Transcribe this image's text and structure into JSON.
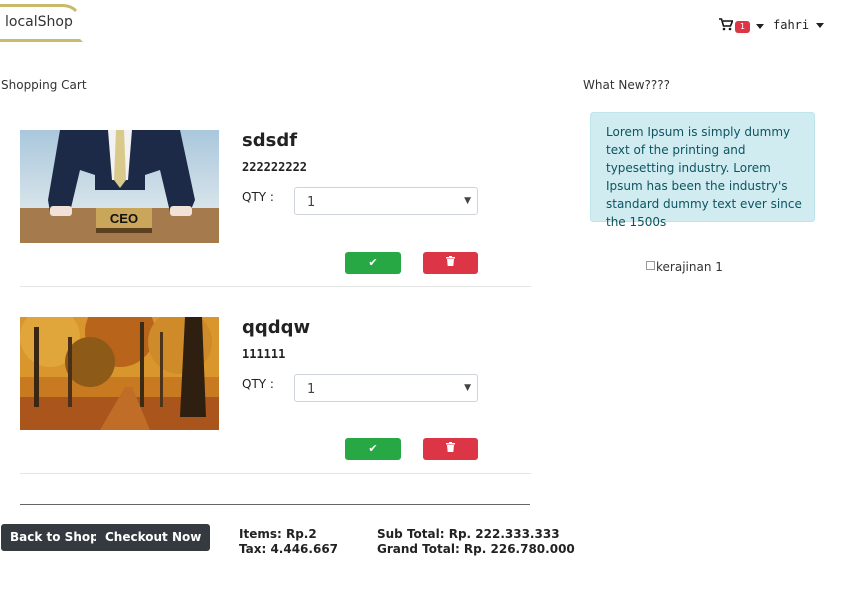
{
  "navbar": {
    "brand": "localShop",
    "cart_badge": "1",
    "user": "fahri"
  },
  "cart": {
    "title": "Shopping Cart",
    "items": [
      {
        "name": "sdsdf",
        "price": "222222222",
        "qty_label": "QTY :",
        "qty_value": "1",
        "image": "ceo-desk-photo"
      },
      {
        "name": "qqdqw",
        "price": "111111",
        "qty_label": "QTY :",
        "qty_value": "1",
        "image": "autumn-forest-photo"
      }
    ],
    "back_label": "Back to Shop",
    "checkout_label": "Checkout Now",
    "items_text": "Items: Rp.2",
    "tax_text": "Tax: 4.446.667",
    "subtotal_text": "Sub Total: Rp. 222.333.333",
    "grandtotal_text": "Grand Total: Rp. 226.780.000"
  },
  "sidebar": {
    "title": "What New????",
    "info": "Lorem Ipsum is simply dummy text of the printing and typesetting industry. Lorem Ipsum has been the industry's standard dummy text ever since the 1500s",
    "image_alt": "kerajinan 1"
  },
  "colors": {
    "accent": "#c9b96b",
    "success": "#28a745",
    "danger": "#dc3545",
    "dark": "#343a40",
    "info_bg": "#d1ecf1"
  }
}
